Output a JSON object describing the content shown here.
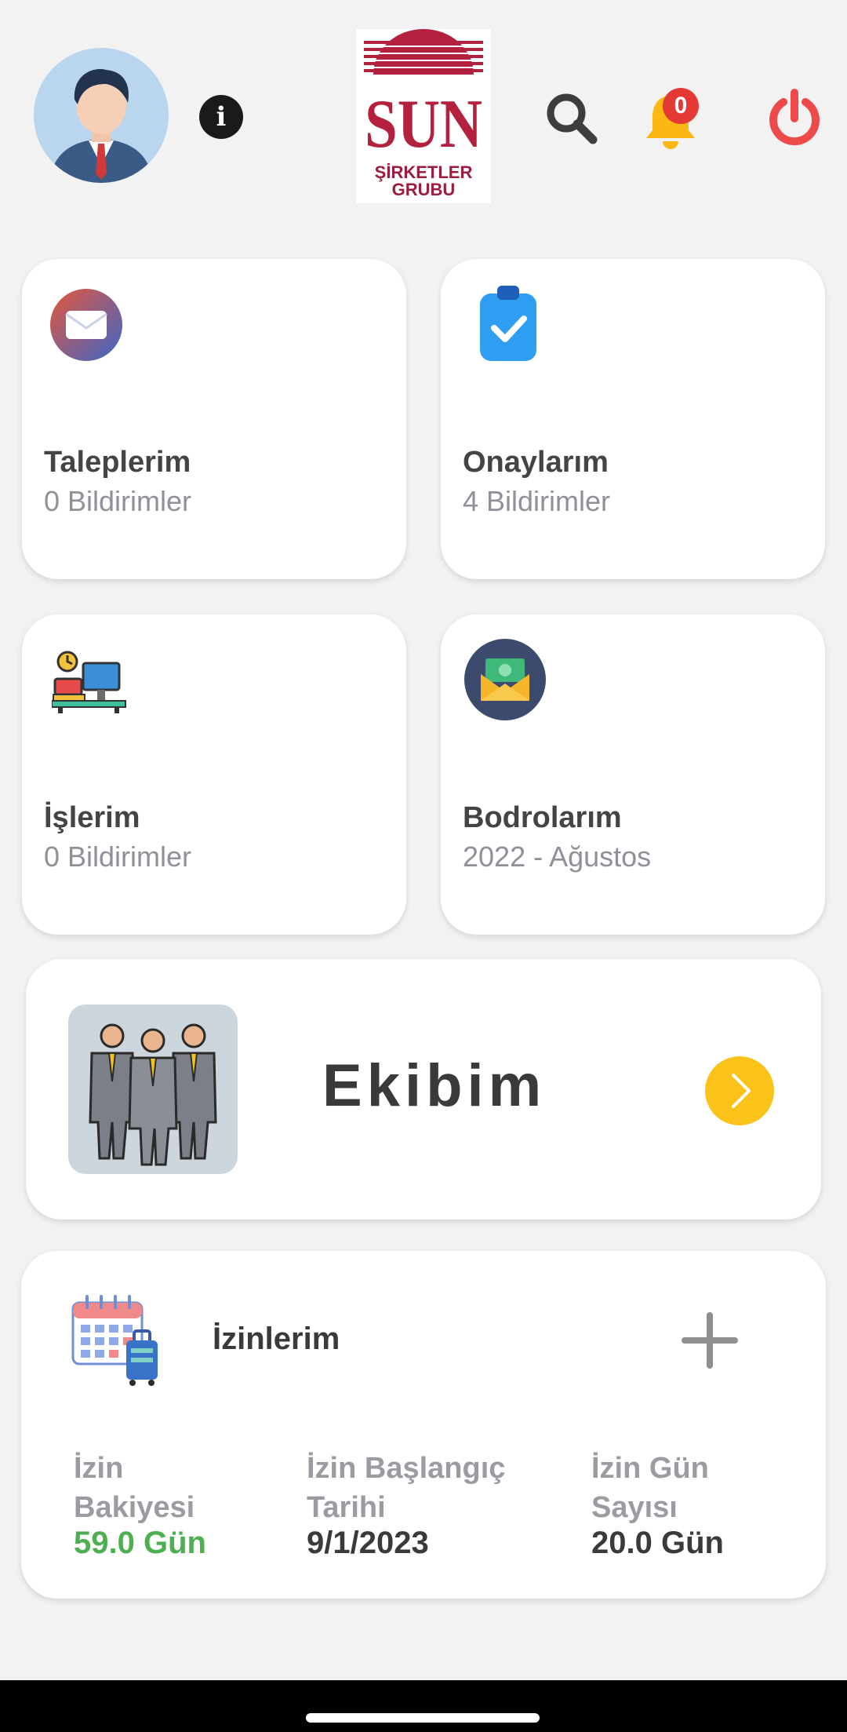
{
  "header": {
    "info_glyph": "i",
    "logo_text": "SUN",
    "logo_line1": "ŞİRKETLER",
    "logo_line2": "GRUBU",
    "notification_count": "0",
    "colors": {
      "bell": "#fbb714",
      "power": "#ef4a4a",
      "badge": "#e53935"
    }
  },
  "tiles": [
    {
      "title": "Taleplerim",
      "subtitle": "0 Bildirimler",
      "icon": "envelope-icon"
    },
    {
      "title": "Onaylarım",
      "subtitle": "4 Bildirimler",
      "icon": "clipboard-check-icon"
    },
    {
      "title": "İşlerim",
      "subtitle": "0 Bildirimler",
      "icon": "workdesk-icon"
    },
    {
      "title": "Bodrolarım",
      "subtitle": "2022 - Ağustos",
      "icon": "payroll-envelope-icon"
    }
  ],
  "team": {
    "title": "Ekibim",
    "icon": "team-people-icon",
    "arrow_color": "#fbc21a"
  },
  "leave": {
    "title": "İzinlerim",
    "icon": "calendar-luggage-icon",
    "stats": [
      {
        "label_line1": "İzin",
        "label_line2": "Bakiyesi",
        "value": "59.0 Gün",
        "color": "#4caf50"
      },
      {
        "label_line1": "İzin Başlangıç",
        "label_line2": "Tarihi",
        "value": "9/1/2023",
        "color": "#3a3a3a"
      },
      {
        "label_line1": "İzin Gün",
        "label_line2": "Sayısı",
        "value": "20.0 Gün",
        "color": "#3a3a3a"
      }
    ]
  }
}
